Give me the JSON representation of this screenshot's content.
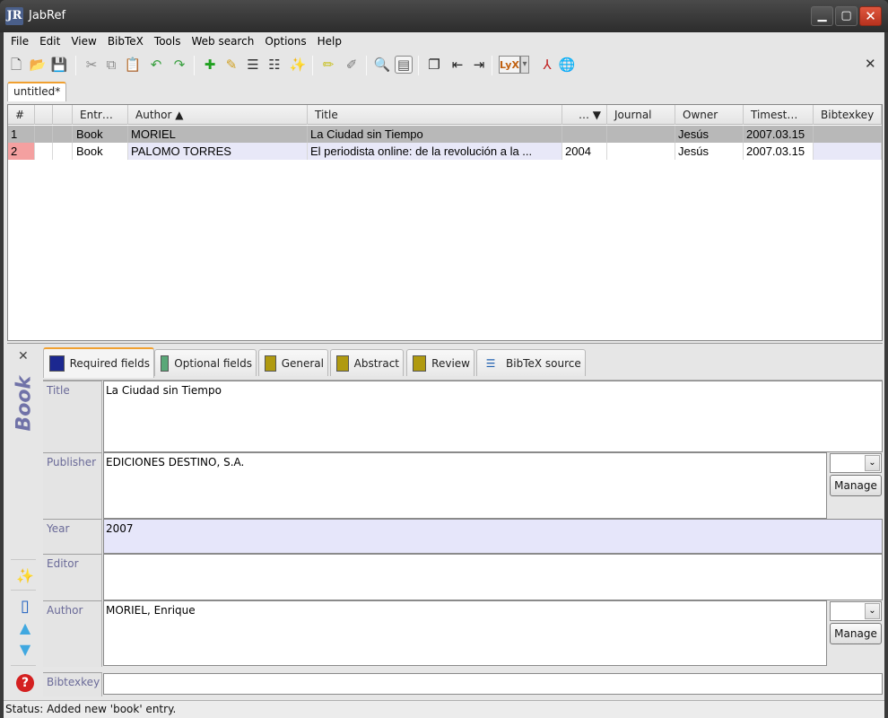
{
  "window": {
    "title": "JabRef",
    "logo": "JR"
  },
  "menu": [
    "File",
    "Edit",
    "View",
    "BibTeX",
    "Tools",
    "Web search",
    "Options",
    "Help"
  ],
  "toolbar": {
    "icons": [
      {
        "name": "new-database-icon",
        "glyph": "🗋"
      },
      {
        "name": "open-database-icon",
        "glyph": "📂"
      },
      {
        "name": "save-database-icon",
        "glyph": "💾"
      },
      {
        "name": "cut-icon",
        "glyph": "✂"
      },
      {
        "name": "copy-icon",
        "glyph": "⧉"
      },
      {
        "name": "paste-icon",
        "glyph": "📋"
      },
      {
        "name": "undo-icon",
        "glyph": "↶"
      },
      {
        "name": "redo-icon",
        "glyph": "↷"
      },
      {
        "name": "new-entry-icon",
        "glyph": "✚"
      },
      {
        "name": "edit-entry-icon",
        "glyph": "✎"
      },
      {
        "name": "edit-preamble-icon",
        "glyph": "☰"
      },
      {
        "name": "edit-strings-icon",
        "glyph": "☷"
      },
      {
        "name": "autogenerate-keys-icon",
        "glyph": "✨"
      },
      {
        "name": "mark-entries-icon",
        "glyph": "✏"
      },
      {
        "name": "unmark-entries-icon",
        "glyph": "✐"
      },
      {
        "name": "search-icon",
        "glyph": "🔍"
      },
      {
        "name": "toggle-preview-icon",
        "glyph": "▤"
      },
      {
        "name": "toggle-groups-icon",
        "glyph": "❐"
      },
      {
        "name": "push-left-icon",
        "glyph": "⇤"
      },
      {
        "name": "push-right-icon",
        "glyph": "⇥"
      },
      {
        "name": "push-to-lyx-icon",
        "glyph": "LyX"
      },
      {
        "name": "lyx-dropdown-icon",
        "glyph": "▾"
      },
      {
        "name": "open-pdf-icon",
        "glyph": "⅄"
      },
      {
        "name": "open-url-icon",
        "glyph": "🌐"
      }
    ],
    "close_glyph": "✕"
  },
  "database_tab": "untitled*",
  "table": {
    "columns": [
      "#",
      "",
      "",
      "Entr…",
      "Author ▲",
      "Title",
      "… ▼",
      "Journal",
      "Owner",
      "Timest…",
      "Bibtexkey"
    ],
    "rows": [
      {
        "num": "1",
        "type": "Book",
        "author": "MORIEL",
        "title": "La Ciudad sin Tiempo",
        "year": "",
        "journal": "",
        "owner": "Jesús",
        "timestamp": "2007.03.15",
        "bibtexkey": ""
      },
      {
        "num": "2",
        "type": "Book",
        "author": "PALOMO TORRES",
        "title": "El periodista online: de la revolución a la ...",
        "year": "2004",
        "journal": "",
        "owner": "Jesús",
        "timestamp": "2007.03.15",
        "bibtexkey": ""
      }
    ]
  },
  "editor": {
    "entry_type": "Book",
    "close_glyph": "✕",
    "tabs": [
      {
        "label": "Required fields",
        "color": "#1c2890"
      },
      {
        "label": "Optional fields",
        "color": "#5aa878"
      },
      {
        "label": "General",
        "color": "#b09a10"
      },
      {
        "label": "Abstract",
        "color": "#b09a10"
      },
      {
        "label": "Review",
        "color": "#b09a10"
      },
      {
        "label": "BibTeX source",
        "color": ""
      }
    ],
    "fields": [
      {
        "label": "Title",
        "value": "La Ciudad sin Tiempo"
      },
      {
        "label": "Publisher",
        "value": "EDICIONES DESTINO, S.A."
      },
      {
        "label": "Year",
        "value": "2007"
      },
      {
        "label": "Editor",
        "value": ""
      },
      {
        "label": "Author",
        "value": "MORIEL, Enrique"
      },
      {
        "label": "Bibtexkey",
        "value": ""
      }
    ],
    "manage_label": "Manage",
    "side_icons": [
      {
        "name": "generate-key-icon",
        "glyph": "✨"
      },
      {
        "name": "store-entry-icon",
        "glyph": "▯"
      },
      {
        "name": "previous-entry-icon",
        "glyph": "▲"
      },
      {
        "name": "next-entry-icon",
        "glyph": "▼"
      },
      {
        "name": "help-icon",
        "glyph": "?"
      }
    ]
  },
  "status": {
    "label": "Status:",
    "message": "Added new 'book' entry."
  }
}
